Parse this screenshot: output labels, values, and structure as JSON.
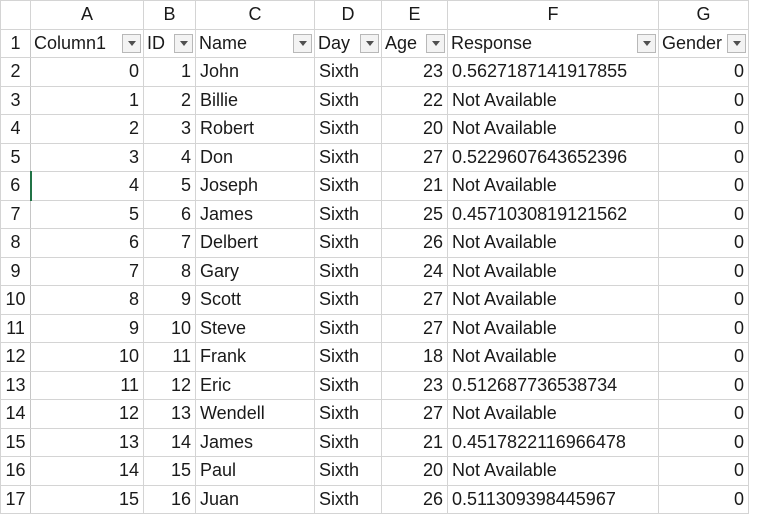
{
  "columns": [
    "A",
    "B",
    "C",
    "D",
    "E",
    "F",
    "G"
  ],
  "headers": [
    "Column1",
    "ID",
    "Name",
    "Day",
    "Age",
    "Response",
    "Gender"
  ],
  "row_numbers": [
    "1",
    "2",
    "3",
    "4",
    "5",
    "6",
    "7",
    "8",
    "9",
    "10",
    "11",
    "12",
    "13",
    "14",
    "15",
    "16",
    "17"
  ],
  "rows": [
    {
      "col1": "0",
      "id": "1",
      "name": "John",
      "day": "Sixth",
      "age": "23",
      "response": "0.5627187141917855",
      "gender": "0"
    },
    {
      "col1": "1",
      "id": "2",
      "name": "Billie",
      "day": "Sixth",
      "age": "22",
      "response": "Not Available",
      "gender": "0"
    },
    {
      "col1": "2",
      "id": "3",
      "name": "Robert",
      "day": "Sixth",
      "age": "20",
      "response": "Not Available",
      "gender": "0"
    },
    {
      "col1": "3",
      "id": "4",
      "name": "Don",
      "day": "Sixth",
      "age": "27",
      "response": "0.5229607643652396",
      "gender": "0"
    },
    {
      "col1": "4",
      "id": "5",
      "name": "Joseph",
      "day": "Sixth",
      "age": "21",
      "response": "Not Available",
      "gender": "0"
    },
    {
      "col1": "5",
      "id": "6",
      "name": "James",
      "day": "Sixth",
      "age": "25",
      "response": "0.4571030819121562",
      "gender": "0"
    },
    {
      "col1": "6",
      "id": "7",
      "name": "Delbert",
      "day": "Sixth",
      "age": "26",
      "response": "Not Available",
      "gender": "0"
    },
    {
      "col1": "7",
      "id": "8",
      "name": "Gary",
      "day": "Sixth",
      "age": "24",
      "response": "Not Available",
      "gender": "0"
    },
    {
      "col1": "8",
      "id": "9",
      "name": "Scott",
      "day": "Sixth",
      "age": "27",
      "response": "Not Available",
      "gender": "0"
    },
    {
      "col1": "9",
      "id": "10",
      "name": "Steve",
      "day": "Sixth",
      "age": "27",
      "response": "Not Available",
      "gender": "0"
    },
    {
      "col1": "10",
      "id": "11",
      "name": "Frank",
      "day": "Sixth",
      "age": "18",
      "response": "Not Available",
      "gender": "0"
    },
    {
      "col1": "11",
      "id": "12",
      "name": "Eric",
      "day": "Sixth",
      "age": "23",
      "response": "0.512687736538734",
      "gender": "0"
    },
    {
      "col1": "12",
      "id": "13",
      "name": "Wendell",
      "day": "Sixth",
      "age": "27",
      "response": "Not Available",
      "gender": "0"
    },
    {
      "col1": "13",
      "id": "14",
      "name": "James",
      "day": "Sixth",
      "age": "21",
      "response": "0.4517822116966478",
      "gender": "0"
    },
    {
      "col1": "14",
      "id": "15",
      "name": "Paul",
      "day": "Sixth",
      "age": "20",
      "response": "Not Available",
      "gender": "0"
    },
    {
      "col1": "15",
      "id": "16",
      "name": "Juan",
      "day": "Sixth",
      "age": "26",
      "response": "0.511309398445967",
      "gender": "0"
    }
  ],
  "active_row": "6",
  "accent_color": "#217346"
}
